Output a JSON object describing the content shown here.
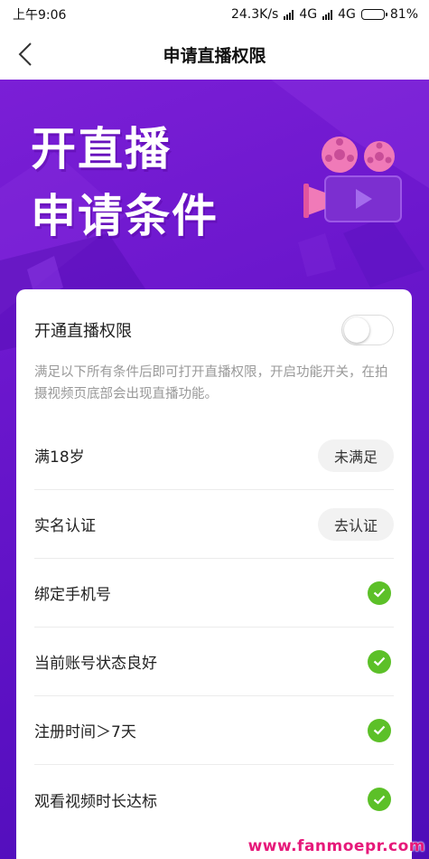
{
  "status_bar": {
    "time": "上午9:06",
    "network_speed": "24.3K/s",
    "signal1": "4G",
    "signal2": "4G",
    "battery": "81%",
    "battery_level": 0.81
  },
  "nav": {
    "title": "申请直播权限",
    "back_icon": "chevron-left-icon"
  },
  "banner": {
    "line1": "开直播",
    "line2": "申请条件",
    "illustration": "movie-camera-icon"
  },
  "permission": {
    "label": "开通直播权限",
    "enabled": false,
    "description": "满足以下所有条件后即可打开直播权限，开启功能开关，在拍摄视频页底部会出现直播功能。"
  },
  "conditions": [
    {
      "label": "满18岁",
      "status": "pill",
      "action": "未满足"
    },
    {
      "label": "实名认证",
      "status": "pill",
      "action": "去认证"
    },
    {
      "label": "绑定手机号",
      "status": "done"
    },
    {
      "label": "当前账号状态良好",
      "status": "done"
    },
    {
      "label": "注册时间＞7天",
      "status": "done"
    },
    {
      "label": "观看视频时长达标",
      "status": "done"
    }
  ],
  "colors": {
    "banner": "#6a16cc",
    "check": "#5cc028",
    "watermark": "#e6197a"
  },
  "watermark": "www.fanmoepr.com"
}
